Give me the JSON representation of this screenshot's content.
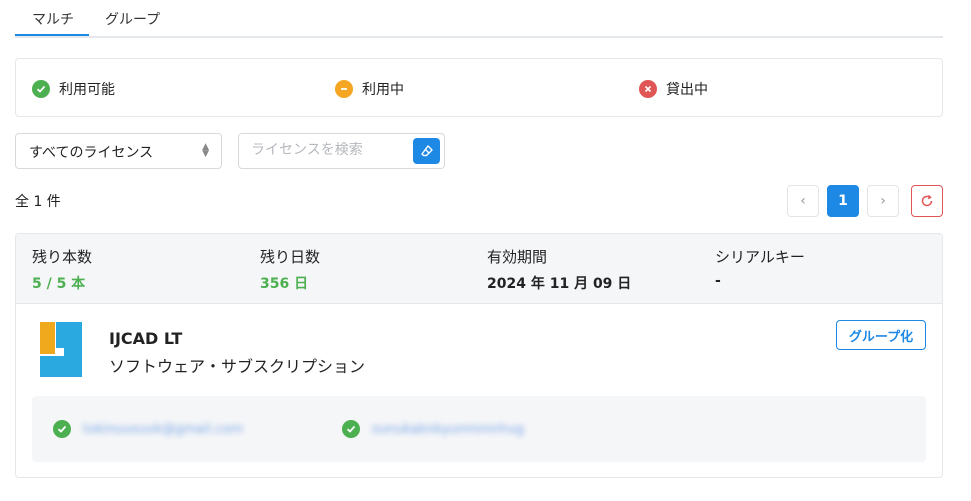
{
  "tabs": [
    "マルチ",
    "グループ"
  ],
  "statuses": {
    "available": "利用可能",
    "in_use": "利用中",
    "lent": "貸出中"
  },
  "filter": {
    "selected": "すべてのライセンス"
  },
  "search": {
    "placeholder": "ライセンスを検索"
  },
  "results": {
    "count_text": "全 1 件"
  },
  "pagination": {
    "current_page": "1",
    "prev": "‹",
    "next": "›"
  },
  "license": {
    "headers": {
      "remaining_count": "残り本数",
      "remaining_days": "残り日数",
      "valid_until": "有効期間",
      "serial_key": "シリアルキー"
    },
    "values": {
      "remaining_count": "5 / 5 本",
      "remaining_days": "356 日",
      "valid_until": "2024 年 11 月 09 日",
      "serial_key": "-"
    },
    "product_name": "IJCAD LT",
    "product_type": "ソフトウェア・サブスクリプション",
    "group_button": "グループ化",
    "users": [
      "tokinuusuvk@gmail.com",
      "sunukaknkyunmmnhug"
    ]
  },
  "colors": {
    "accent": "#1e88e5",
    "available": "#4caf50",
    "in_use": "#f5a623",
    "lent": "#e05555"
  }
}
